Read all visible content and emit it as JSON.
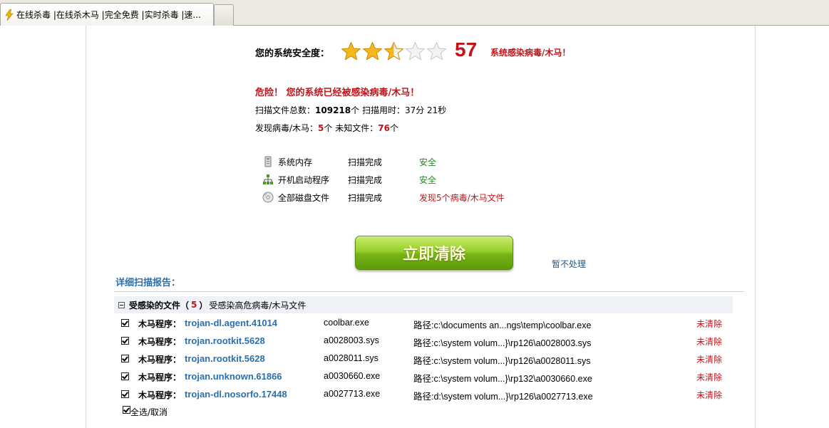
{
  "browser": {
    "tab_title": "在线杀毒 |在线杀木马 |完全免费 |实时杀毒 |速..."
  },
  "summary": {
    "safety_label": "您的系统安全度：",
    "stars_rating": 2.5,
    "stars_total": 5,
    "score": "57",
    "infected_message": "系统感染病毒/木马！",
    "danger_message": "危险！ 您的系统已经被感染病毒/木马！",
    "scan_total_label": "扫描文件总数：",
    "scan_total_value": "109218",
    "scan_total_unit": "个  扫描用时：37分 21秒",
    "found_label": "发现病毒/木马：",
    "found_value": "5",
    "unknown_label": "个  未知文件：",
    "unknown_value": "76",
    "unknown_unit": "个"
  },
  "scan_items": [
    {
      "name": "系统内存",
      "status": "扫描完成",
      "result": "安全",
      "icon": "memory-icon",
      "result_type": "safe"
    },
    {
      "name": "开机启动程序",
      "status": "扫描完成",
      "result": "安全",
      "icon": "startup-icon",
      "result_type": "safe"
    },
    {
      "name": "全部磁盘文件",
      "status": "扫描完成",
      "result": "发现5个病毒/木马文件",
      "icon": "disk-icon",
      "result_type": "found"
    }
  ],
  "actions": {
    "clean_label": "立即清除",
    "skip_label": "暂不处理"
  },
  "report": {
    "title": "详细扫描报告：",
    "group_label": "受感染的文件（",
    "group_count": "5",
    "group_close": "）",
    "group_desc": "受感染高危病毒/木马文件",
    "threat_label": "木马程序：",
    "rows": [
      {
        "name": "trojan-dl.agent.41014",
        "file": "coolbar.exe",
        "path": "路径:c:\\documents an...ngs\\temp\\coolbar.exe",
        "status": "未清除"
      },
      {
        "name": "trojan.rootkit.5628",
        "file": "a0028003.sys",
        "path": "路径:c:\\system volum...}\\rp126\\a0028003.sys",
        "status": "未清除"
      },
      {
        "name": "trojan.rootkit.5628",
        "file": "a0028011.sys",
        "path": "路径:c:\\system volum...}\\rp126\\a0028011.sys",
        "status": "未清除"
      },
      {
        "name": "trojan.unknown.61866",
        "file": "a0030660.exe",
        "path": "路径:c:\\system volum...}\\rp132\\a0030660.exe",
        "status": "未清除"
      },
      {
        "name": "trojan-dl.nosorfo.17448",
        "file": "a0027713.exe",
        "path": "路径:d:\\system volum...}\\rp126\\a0027713.exe",
        "status": "未清除"
      }
    ],
    "select_all_label": "全选/取消"
  },
  "colors": {
    "danger": "#c0141a",
    "safe": "#228b22",
    "link": "#2a70b0",
    "button_green": "#77b314",
    "star_gold": "#f5b81c"
  }
}
